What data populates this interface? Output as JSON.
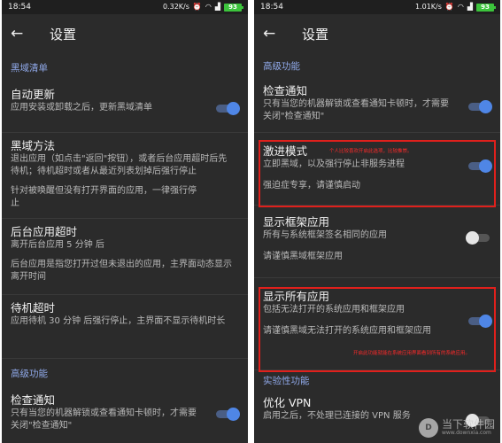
{
  "left": {
    "status": {
      "time": "18:54",
      "speed": "0.32K/s",
      "battery": "93"
    },
    "app_title": "设置",
    "sections": {
      "blacklist": "黑域清单",
      "advanced": "高级功能"
    },
    "items": {
      "auto_update": {
        "title": "自动更新",
        "desc": "应用安装或卸载之后，更新黑域清单",
        "toggle": "on"
      },
      "method": {
        "title": "黑域方法",
        "desc": "退出应用（如点击\"返回\"按钮），或者后台应用超时后先待机；待机超时或者从最近列表划掉后强行停止",
        "note": "针对被唤醒但没有打开界面的应用，一律强行停止"
      },
      "bg_timeout": {
        "title": "后台应用超时",
        "desc": "离开后台应用 5 分钟 后",
        "note": "后台应用是指您打开过但未退出的应用，主界面动态显示离开时间"
      },
      "standby_timeout": {
        "title": "待机超时",
        "desc": "应用待机 30 分钟 后强行停止，主界面不显示待机时长"
      },
      "check_notify": {
        "title": "检查通知",
        "desc": "只有当您的机器解锁或查看通知卡顿时，才需要关闭\"检查通知\"",
        "toggle": "on"
      }
    }
  },
  "right": {
    "status": {
      "time": "18:54",
      "speed": "1.01K/s",
      "battery": "93"
    },
    "app_title": "设置",
    "sections": {
      "advanced": "高级功能",
      "experimental": "实验性功能"
    },
    "items": {
      "check_notify": {
        "title": "检查通知",
        "desc": "只有当您的机器解锁或查看通知卡顿时，才需要关闭\"检查通知\"",
        "toggle": "on"
      },
      "aggressive": {
        "title": "激进模式",
        "desc": "立即黑域，以及强行停止非服务进程",
        "note": "强迫症专享，请谨慎启动",
        "toggle": "on"
      },
      "show_framework": {
        "title": "显示框架应用",
        "desc": "所有与系统框架签名相同的应用",
        "note": "请谨慎黑域框架应用",
        "toggle": "off"
      },
      "show_all": {
        "title": "显示所有应用",
        "desc": "包括无法打开的系统应用和框架应用",
        "note": "请谨慎黑域无法打开的系统应用和框架应用",
        "toggle": "on"
      },
      "optimize_vpn": {
        "title": "优化 VPN",
        "desc": "启用之后，不处理已连接的 VPN 服务",
        "toggle": "off"
      }
    },
    "annotations": {
      "aggressive": "个人比较喜欢开启此选项，比较推崇。",
      "show_all": "开启此功能就能在系统应用界面看到所有的系统应用。"
    }
  },
  "watermark": {
    "cn": "当下软件园",
    "en": "www.downxia.com"
  },
  "colors": {
    "accent": "#4f86e6",
    "section": "#8fa8e8",
    "highlight": "#e0201c",
    "bg": "#2b2b2b"
  }
}
